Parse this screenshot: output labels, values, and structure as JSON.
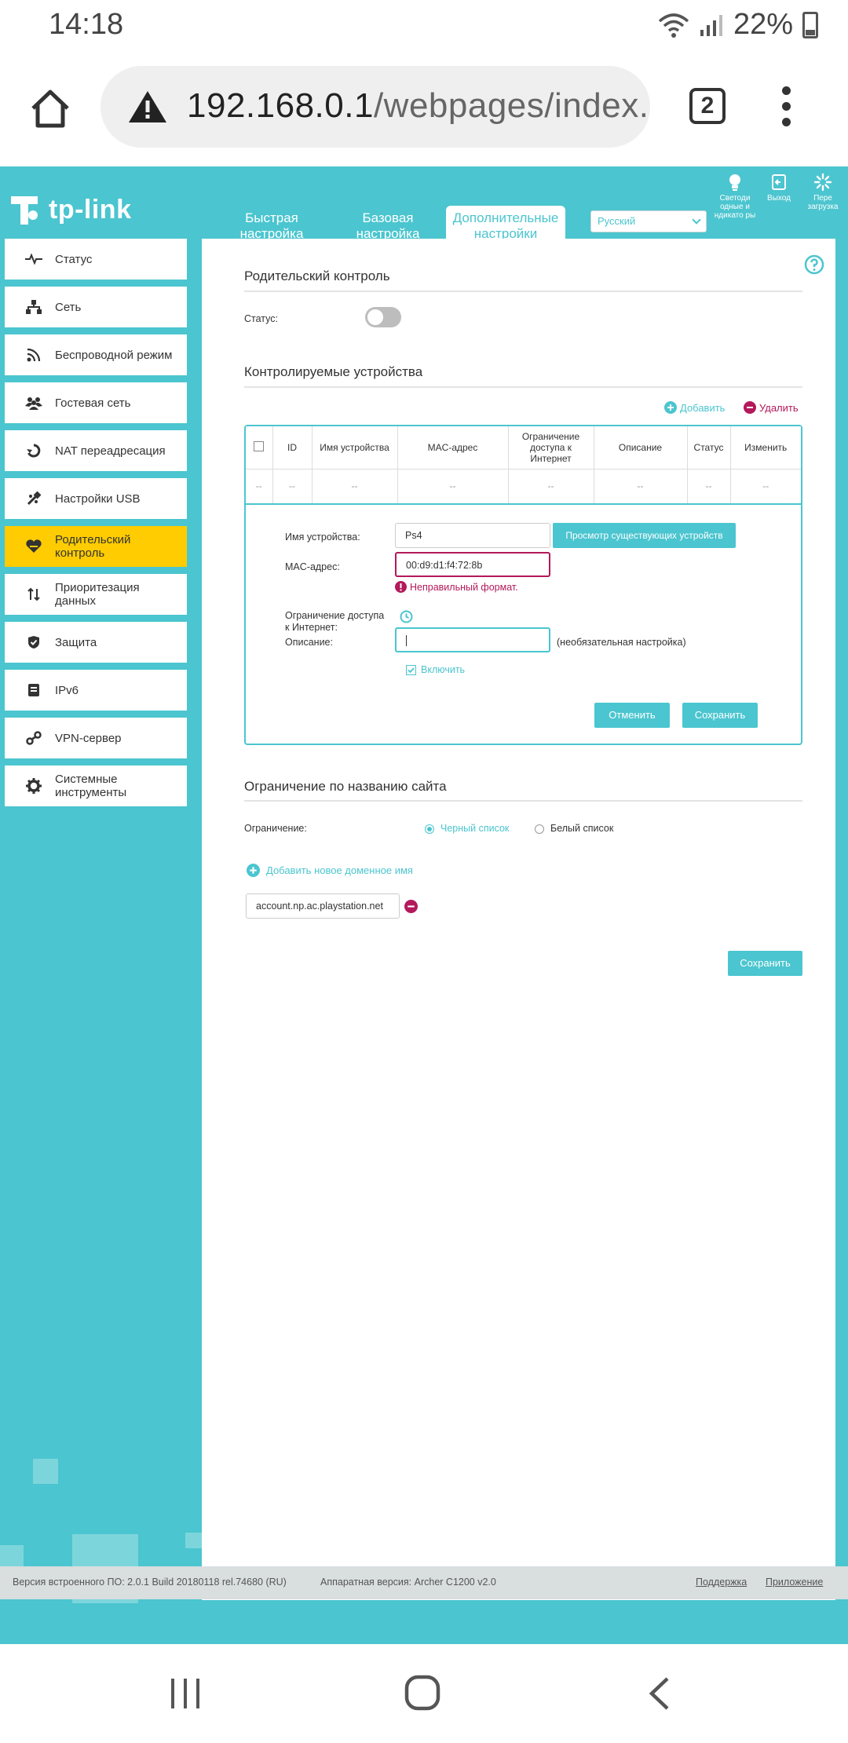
{
  "status_bar": {
    "time": "14:18",
    "battery": "22%",
    "battery_level": 0.22
  },
  "browser": {
    "url_host": "192.168.0.1",
    "url_path": "/webpages/index.",
    "tab_count": "2"
  },
  "header": {
    "brand": "tp-link",
    "tabs": [
      {
        "line1": "Быстрая",
        "line2": "настройка"
      },
      {
        "line1": "Базовая",
        "line2": "настройка"
      },
      {
        "line1": "Дополнительные",
        "line2": "настройки"
      }
    ],
    "language": "Русский",
    "icons": [
      {
        "label": "Светоди одные и ндикато ры"
      },
      {
        "label": "Выход"
      },
      {
        "label": "Пере загрузка"
      }
    ]
  },
  "sidebar": {
    "items": [
      {
        "label": "Статус"
      },
      {
        "label": "Сеть"
      },
      {
        "label": "Беспроводной режим"
      },
      {
        "label": "Гостевая сеть"
      },
      {
        "label": "NAT переадресация"
      },
      {
        "label": "Настройки USB"
      },
      {
        "label": "Родительский контроль"
      },
      {
        "label": "Приоритезация данных"
      },
      {
        "label": "Защита"
      },
      {
        "label": "IPv6"
      },
      {
        "label": "VPN-сервер"
      },
      {
        "label": "Системные инструменты"
      }
    ]
  },
  "parental": {
    "title": "Родительский контроль",
    "status_label": "Статус:",
    "status_on": false
  },
  "devices": {
    "title": "Контролируемые устройства",
    "add_label": "Добавить",
    "delete_label": "Удалить",
    "columns": [
      "ID",
      "Имя устройства",
      "MAC-адрес",
      "Ограничение доступа к Интернет",
      "Описание",
      "Статус",
      "Изменить"
    ],
    "empty_cell": "--",
    "form": {
      "name_label": "Имя устройства:",
      "name_value": "Ps4",
      "browse_button": "Просмотр существующих устройств",
      "mac_label": "MAC-адрес:",
      "mac_value": "00:d9:d1:f4:72:8b",
      "mac_error": "Неправильный формат.",
      "limit_label_1": "Ограничение доступа",
      "limit_label_2": "к Интернет:",
      "desc_label": "Описание:",
      "desc_hint": "(необязательная настройка)",
      "enable_label": "Включить",
      "cancel_button": "Отменить",
      "save_button": "Сохранить"
    }
  },
  "site_limit": {
    "title": "Ограничение по названию сайта",
    "limit_label": "Ограничение:",
    "blacklist": "Черный список",
    "whitelist": "Белый список",
    "add_domain": "Добавить новое доменное имя",
    "domain": "account.np.ac.playstation.net",
    "save_button": "Сохранить"
  },
  "footer": {
    "firmware": "Версия встроенного ПО: 2.0.1 Build 20180118 rel.74680 (RU)",
    "hardware": "Аппаратная версия: Archer C1200 v2.0",
    "support": "Поддержка",
    "app": "Приложение"
  },
  "colors": {
    "accent": "#4bc5cf",
    "active_menu": "#fecc00",
    "error": "#b3195b"
  }
}
